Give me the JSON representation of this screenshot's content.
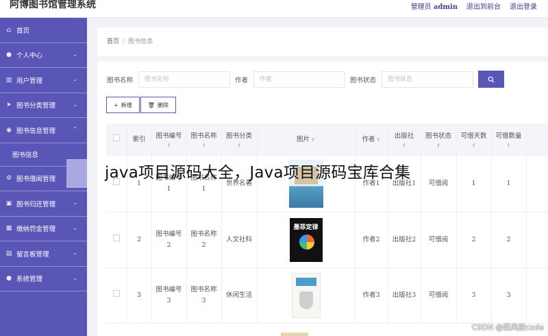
{
  "app": {
    "title": "阿博图书馆管理系统"
  },
  "topnav": {
    "admin_prefix": "管理员",
    "admin_name": "admin",
    "front": "退出到前台",
    "logout": "退出登录"
  },
  "sidebar": {
    "items": [
      {
        "label": "首页",
        "icon": "home-icon",
        "glyph": "⌂"
      },
      {
        "label": "个人中心",
        "icon": "person-icon",
        "glyph": "●"
      },
      {
        "label": "用户管理",
        "icon": "bar-chart-icon",
        "glyph": "▥"
      },
      {
        "label": "图书分类管理",
        "icon": "send-icon",
        "glyph": "➤"
      },
      {
        "label": "图书信息管理",
        "icon": "palette-icon",
        "glyph": "◉"
      },
      {
        "label": "图书借阅管理",
        "icon": "settings-icon",
        "glyph": "⚙"
      },
      {
        "label": "图书归还管理",
        "icon": "image-icon",
        "glyph": "▣"
      },
      {
        "label": "缴纳罚金管理",
        "icon": "table-icon",
        "glyph": "▦"
      },
      {
        "label": "留言板管理",
        "icon": "message-icon",
        "glyph": "▤"
      },
      {
        "label": "系统管理",
        "icon": "user-icon",
        "glyph": "●"
      }
    ],
    "submenu": {
      "label": "图书信息"
    },
    "chevron_down": "⌄",
    "chevron_up": "⌃"
  },
  "breadcrumb": {
    "home": "首页",
    "sep": "/",
    "current": "图书信息"
  },
  "search": {
    "name_label": "图书名称",
    "name_placeholder": "图书名称",
    "author_label": "作者",
    "author_placeholder": "作者",
    "status_label": "图书状态",
    "status_placeholder": "图书状态",
    "button_icon": "search-icon"
  },
  "actions": {
    "add": "新增",
    "add_icon": "+",
    "delete": "删除",
    "delete_icon": "🗑"
  },
  "table": {
    "headers": {
      "index": "索引",
      "book_no": "图书编号",
      "book_name": "图书名称",
      "category": "图书分类",
      "image": "图片",
      "author": "作者",
      "publisher": "出版社",
      "status": "图书状态",
      "days": "可借天数",
      "qty": "可借数量"
    },
    "sort_glyph": "⬍",
    "rows": [
      {
        "index": "1",
        "book_no": [
          "图书编号",
          "1"
        ],
        "book_name": [
          "图书名称",
          "1"
        ],
        "category": "世界名著",
        "author": "作者1",
        "publisher": "出版社1",
        "status": "可借阅",
        "days": "1",
        "qty": "1"
      },
      {
        "index": "2",
        "book_no": [
          "图书编号",
          "2"
        ],
        "book_name": [
          "图书名称",
          "2"
        ],
        "category": "人文社科",
        "author": "作者2",
        "publisher": "出版社2",
        "status": "可借阅",
        "days": "2",
        "qty": "2",
        "cover_title": "墨菲定律"
      },
      {
        "index": "3",
        "book_no": [
          "图书编号",
          "3"
        ],
        "book_name": [
          "图书名称",
          "3"
        ],
        "category": "休闲生活",
        "author": "作者3",
        "publisher": "出版社3",
        "status": "可借阅",
        "days": "3",
        "qty": "3"
      }
    ]
  },
  "overlay": {
    "watermark": "java项目源码大全，Java项目源码宝库合集",
    "csdn": "CSDN @乘风欲code"
  },
  "colors": {
    "brand": "#5a56b8",
    "panel_bg": "#f2f3f7"
  }
}
